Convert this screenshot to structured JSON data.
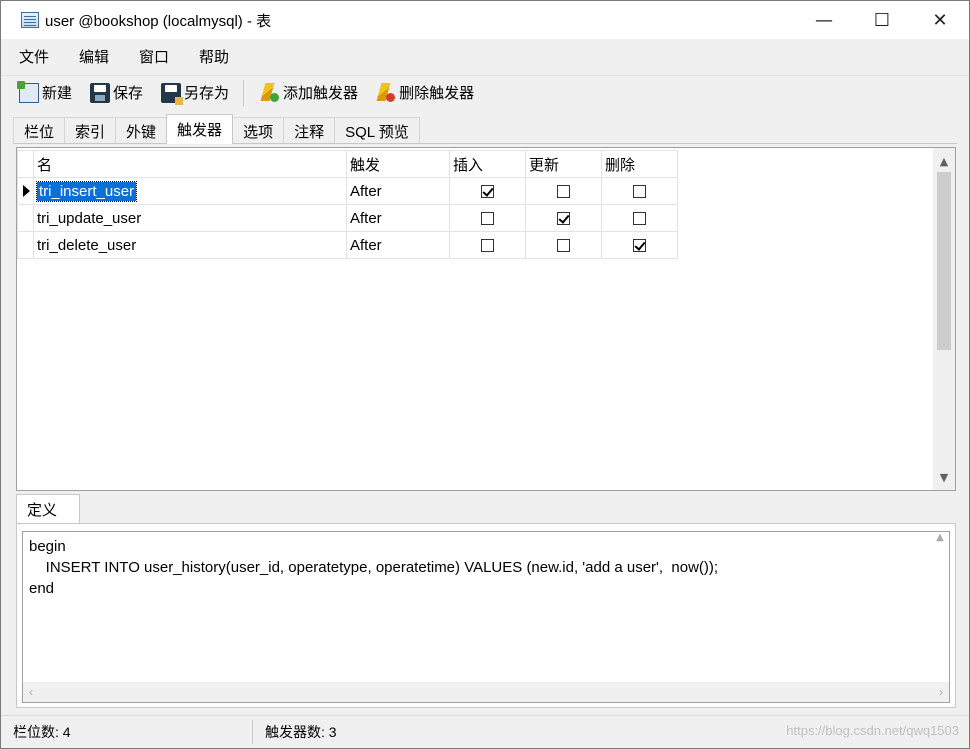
{
  "window": {
    "title": "user @bookshop (localmysql) - 表",
    "controls": {
      "minimize": "—",
      "maximize": "☐",
      "close": "✕"
    }
  },
  "menu": [
    "文件",
    "编辑",
    "窗口",
    "帮助"
  ],
  "toolbar": {
    "new_label": "新建",
    "save_label": "保存",
    "saveas_label": "另存为",
    "add_trigger_label": "添加触发器",
    "delete_trigger_label": "删除触发器"
  },
  "tabs": [
    "栏位",
    "索引",
    "外键",
    "触发器",
    "选项",
    "注释",
    "SQL 预览"
  ],
  "active_tab": "触发器",
  "grid": {
    "headers": {
      "name": "名",
      "fire": "触发",
      "insert": "插入",
      "update": "更新",
      "delete": "删除"
    },
    "rows": [
      {
        "name": "tri_insert_user",
        "fire": "After",
        "insert": true,
        "update": false,
        "delete": false,
        "selected": true
      },
      {
        "name": "tri_update_user",
        "fire": "After",
        "insert": false,
        "update": true,
        "delete": false,
        "selected": false
      },
      {
        "name": "tri_delete_user",
        "fire": "After",
        "insert": false,
        "update": false,
        "delete": true,
        "selected": false
      }
    ]
  },
  "definition": {
    "tab_label": "定义",
    "code_line1": "begin",
    "code_line2": "    INSERT INTO user_history(user_id, operatetype, operatetime) VALUES (new.id, 'add a user',  now());",
    "code_line3": "end"
  },
  "status": {
    "field_count": "栏位数: 4",
    "trigger_count": "触发器数: 3"
  },
  "watermark": "https://blog.csdn.net/qwq1503"
}
